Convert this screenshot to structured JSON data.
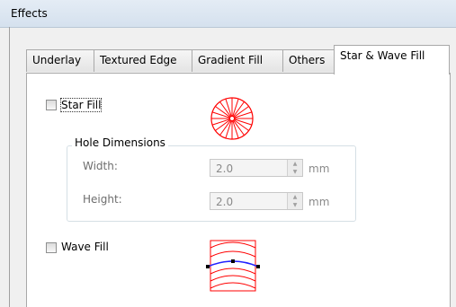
{
  "window": {
    "title": "Effects"
  },
  "tabs": [
    {
      "label": "Underlay"
    },
    {
      "label": "Textured Edge"
    },
    {
      "label": "Gradient Fill"
    },
    {
      "label": "Others"
    },
    {
      "label": "Star & Wave Fill",
      "active": true
    }
  ],
  "star_fill": {
    "label": "Star Fill",
    "checked": false
  },
  "hole_dimensions": {
    "legend": "Hole Dimensions",
    "width_label": "Width:",
    "width_value": "2.0",
    "height_label": "Height:",
    "height_value": "2.0",
    "unit": "mm"
  },
  "wave_fill": {
    "label": "Wave Fill",
    "checked": false
  },
  "colors": {
    "preview_red": "#ff0000",
    "wave_blue": "#2020ff"
  }
}
